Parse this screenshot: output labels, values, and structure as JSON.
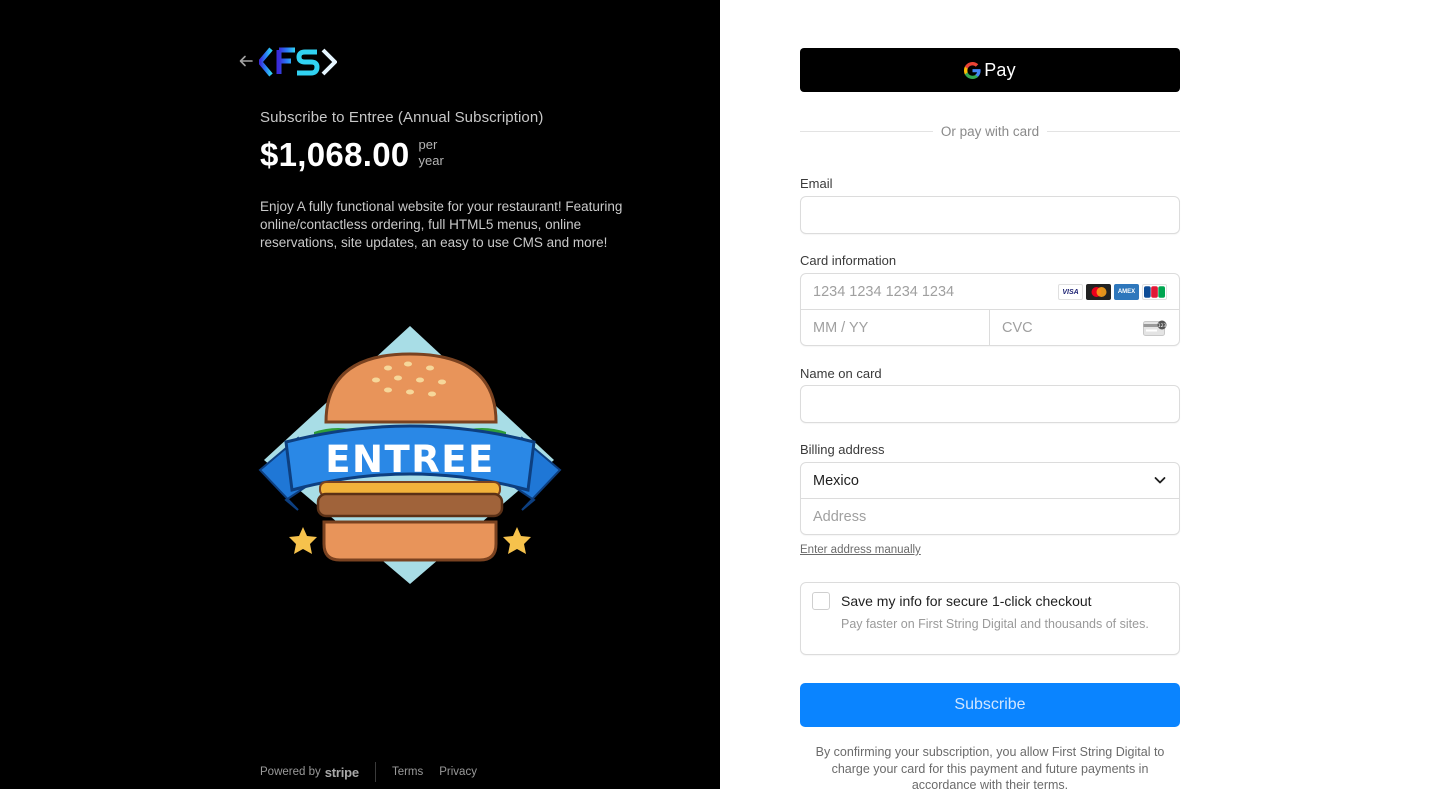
{
  "product": {
    "name": "Subscribe to Entree (Annual Subscription)",
    "price": "$1,068.00",
    "period_line1": "per",
    "period_line2": "year",
    "description": "Enjoy A fully functional website for your restaurant! Featuring online/contactless ordering, full HTML5 menus, online reservations, site updates, an easy to use CMS and more!",
    "hero_text": "ENTREE"
  },
  "footer": {
    "powered_by": "Powered by",
    "brand": "stripe",
    "terms": "Terms",
    "privacy": "Privacy"
  },
  "payment": {
    "gpay_label": "Pay",
    "or_text": "Or pay with card",
    "email_label": "Email",
    "email_value": "",
    "card_label": "Card information",
    "card_number_placeholder": "1234 1234 1234 1234",
    "expiry_placeholder": "MM / YY",
    "cvc_placeholder": "CVC",
    "card_brands": [
      "VISA",
      "mastercard",
      "amex",
      "JCB"
    ],
    "name_label": "Name on card",
    "name_value": "",
    "billing_label": "Billing address",
    "country": "Mexico",
    "address_placeholder": "Address",
    "manual_link": "Enter address manually",
    "save_title": "Save my info for secure 1-click checkout",
    "save_subtitle": "Pay faster on First String Digital and thousands of sites.",
    "save_checked": false,
    "subscribe_label": "Subscribe",
    "legal": "By confirming your subscription, you allow First String Digital to charge your card for this payment and future payments in accordance with their terms."
  },
  "colors": {
    "left_bg": "#000000",
    "accent": "#0a84ff"
  }
}
